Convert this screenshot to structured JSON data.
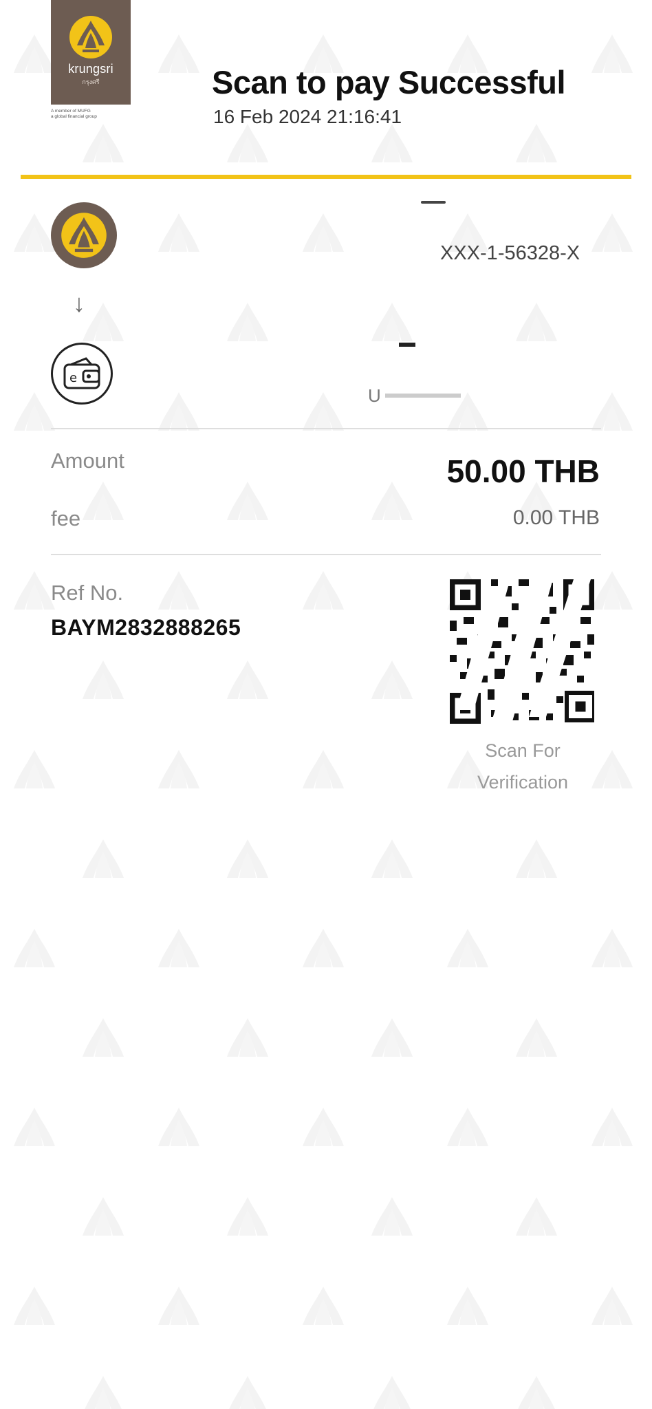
{
  "header": {
    "brand_name": "krungsri",
    "brand_thai": "กรุงศรี",
    "member_line1": "A member of MUFG",
    "member_line2": "a global financial group",
    "title": "Scan to pay Successful",
    "datetime": "16 Feb 2024 21:16:41"
  },
  "transfer": {
    "from_account": "XXX-1-56328-X",
    "to_name_fragment": "U"
  },
  "summary": {
    "amount_label": "Amount",
    "amount_value": "50.00 THB",
    "fee_label": "fee",
    "fee_value": "0.00 THB"
  },
  "reference": {
    "label": "Ref No.",
    "value": "BAYM2832888265"
  },
  "verification": {
    "caption_line1": "Scan For",
    "caption_line2": "Verification"
  },
  "colors": {
    "brand_brown": "#6d5c52",
    "brand_yellow": "#f2c318"
  },
  "icons": {
    "bank": "krungsri-logo-icon",
    "arrow": "arrow-down-icon",
    "wallet": "e-wallet-icon",
    "qr": "qr-code"
  }
}
